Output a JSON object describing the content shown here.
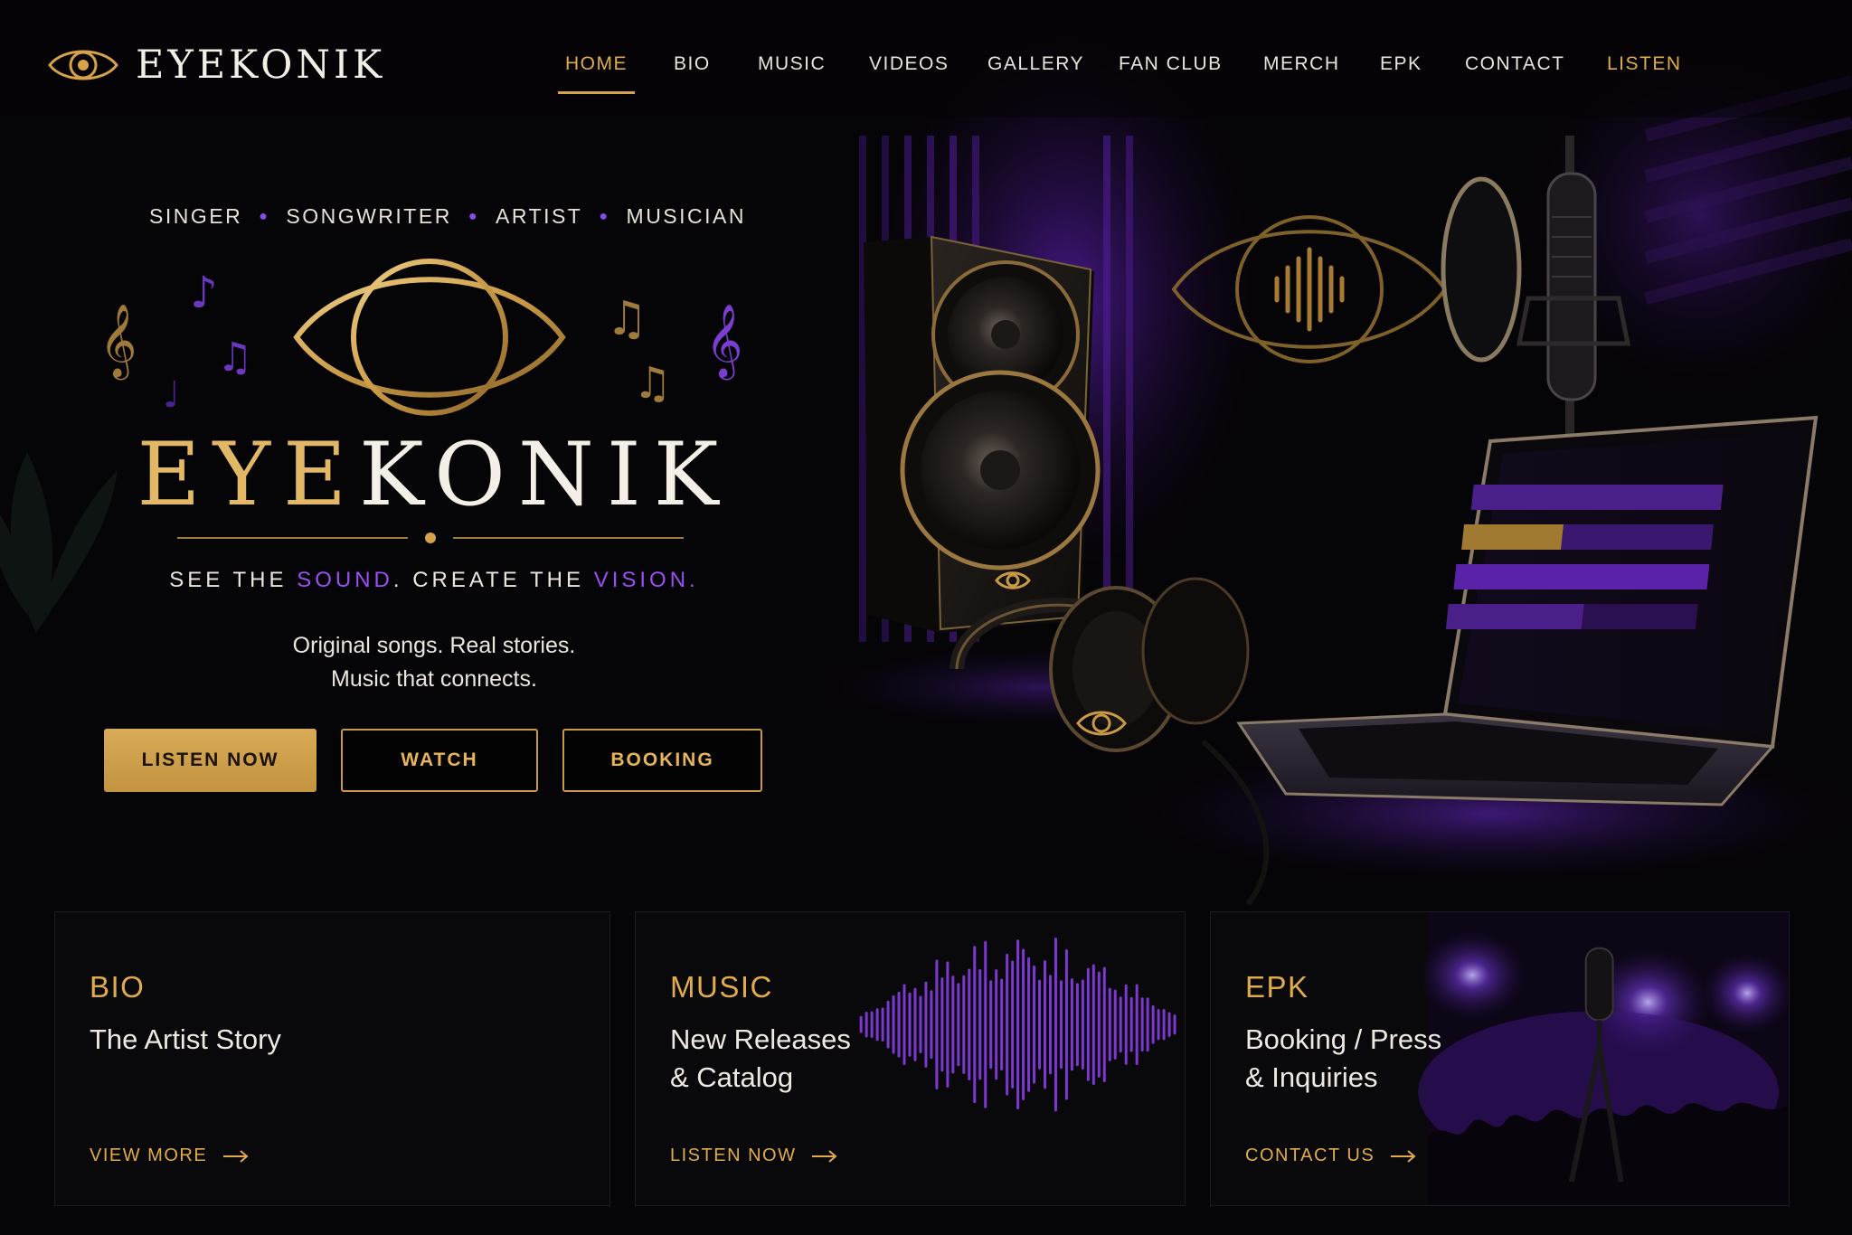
{
  "brand": {
    "name": "EYEKONIK",
    "logo_icon": "eye-soundwave-icon"
  },
  "nav": {
    "items": [
      {
        "label": "HOME",
        "active": true
      },
      {
        "label": "BIO"
      },
      {
        "label": "MUSIC"
      },
      {
        "label": "VIDEOS"
      },
      {
        "label": "GALLERY"
      },
      {
        "label": "FAN CLUB"
      },
      {
        "label": "MERCH"
      },
      {
        "label": "EPK"
      },
      {
        "label": "CONTACT"
      },
      {
        "label": "LISTEN",
        "highlight": true
      }
    ]
  },
  "hero": {
    "roles": [
      "SINGER",
      "SONGWRITER",
      "ARTIST",
      "MUSICIAN"
    ],
    "wordmark_gold": "EYE",
    "wordmark_white": "KONIK",
    "slogan": {
      "part1": "SEE THE ",
      "accent1": "SOUND",
      "part2": ". CREATE THE ",
      "accent2": "VISION",
      "part3": "."
    },
    "sub_line1": "Original songs. Real stories.",
    "sub_line2": "Music that connects.",
    "buttons": {
      "listen_now": "LISTEN NOW",
      "watch": "WATCH",
      "booking": "BOOKING"
    }
  },
  "cards": [
    {
      "title": "BIO",
      "description": "The Artist Story",
      "link": "VIEW MORE"
    },
    {
      "title": "MUSIC",
      "description": "New Releases\n& Catalog",
      "link": "LISTEN NOW"
    },
    {
      "title": "EPK",
      "description": "Booking / Press\n& Inquiries",
      "link": "CONTACT US"
    }
  ],
  "colors": {
    "background": "#050406",
    "gold": "#e0ac4b",
    "purple": "#9a4ff2",
    "text": "#ece6dc"
  }
}
